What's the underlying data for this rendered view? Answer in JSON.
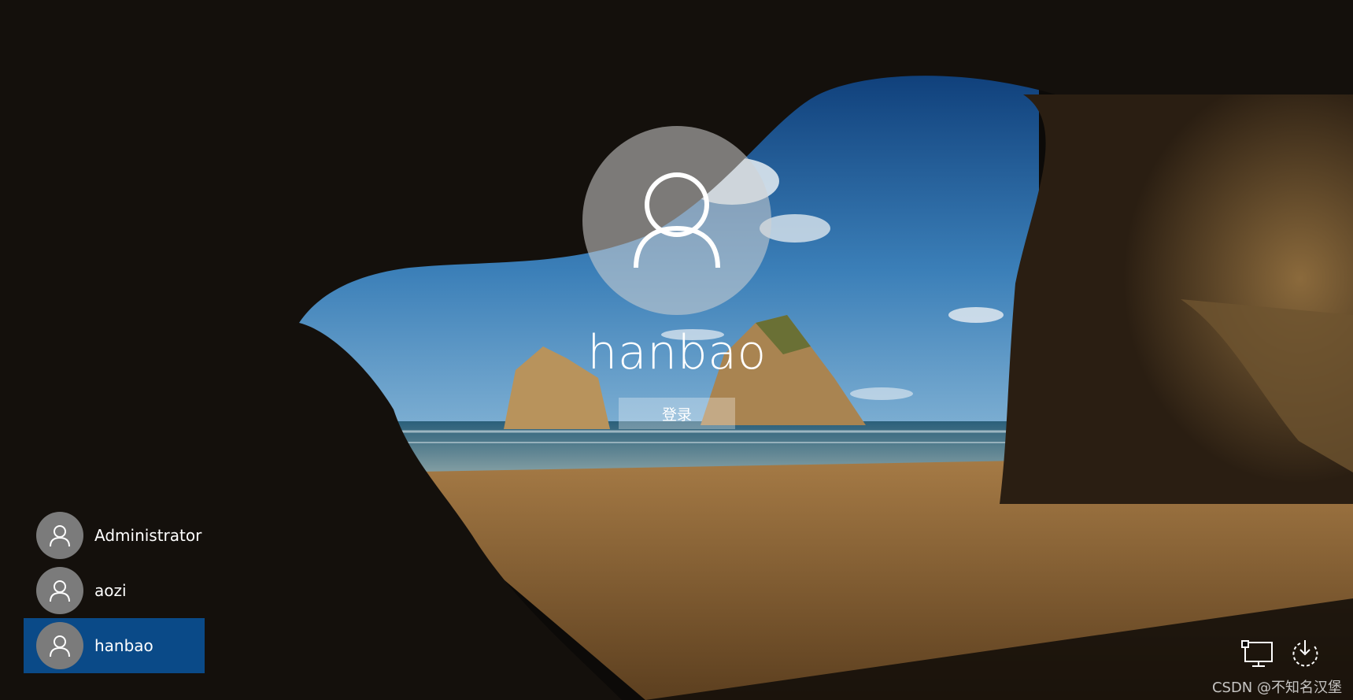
{
  "lock_screen": {
    "current_user": "hanbao",
    "signin_label": "登录"
  },
  "users": [
    {
      "name": "Administrator",
      "selected": false
    },
    {
      "name": "aozi",
      "selected": false
    },
    {
      "name": "hanbao",
      "selected": true
    }
  ],
  "system_icons": [
    "network-icon",
    "power-icon"
  ],
  "watermark": "CSDN @不知名汉堡",
  "colors": {
    "selected_user_bg": "#0a4a88",
    "avatar_gray": "#7b7b7b",
    "sky_blue": "#1f5f9c",
    "sand": "#8a6536"
  }
}
